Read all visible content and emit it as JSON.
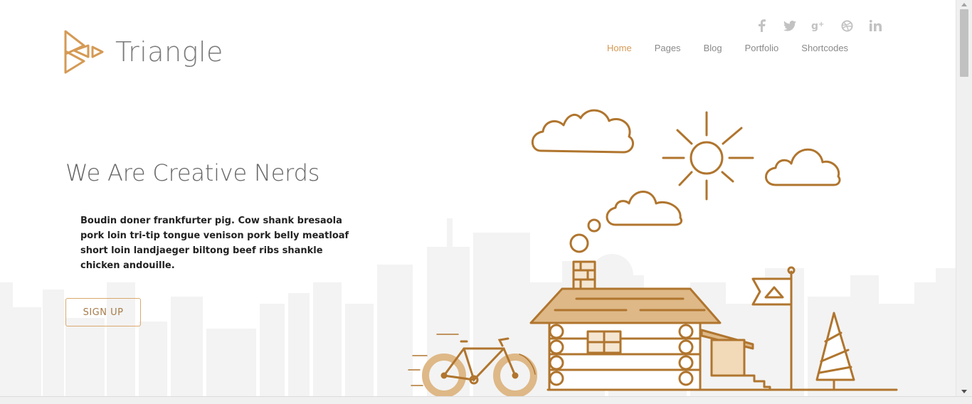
{
  "brand": {
    "name": "Triangle",
    "accent_color": "#d59a55",
    "illustration_color": "#b0752e",
    "fill_color": "#deb887"
  },
  "social": [
    {
      "icon": "facebook-icon",
      "glyph": "f"
    },
    {
      "icon": "twitter-icon",
      "glyph": "ὂ6"
    },
    {
      "icon": "google-plus-icon",
      "glyph": "g+"
    },
    {
      "icon": "dribbble-icon",
      "glyph": "◎"
    },
    {
      "icon": "linkedin-icon",
      "glyph": "in"
    }
  ],
  "nav": {
    "items": [
      {
        "label": "Home",
        "active": true
      },
      {
        "label": "Pages",
        "active": false
      },
      {
        "label": "Blog",
        "active": false
      },
      {
        "label": "Portfolio",
        "active": false
      },
      {
        "label": "Shortcodes",
        "active": false
      }
    ]
  },
  "hero": {
    "title": "We Are Creative Nerds",
    "text": "Boudin doner frankfurter pig. Cow shank bresaola pork loin tri-tip tongue venison pork belly meatloaf short loin landjaeger biltong beef ribs shankle chicken andouille.",
    "button_label": "SIGN UP"
  }
}
